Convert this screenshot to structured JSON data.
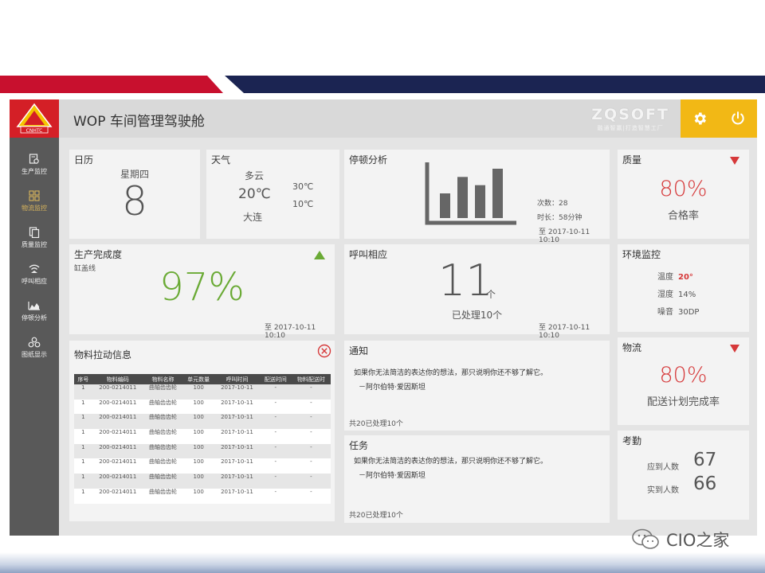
{
  "app": {
    "title": "WOP 车间管理驾驶舱",
    "logo_text": "CNHTC",
    "brand_name": "ZQSOFT",
    "brand_tagline": "融通智赢|打造智慧工厂"
  },
  "sidebar": {
    "items": [
      {
        "label": "生产监控",
        "icon": "production-monitor-icon"
      },
      {
        "label": "物流监控",
        "icon": "logistics-grid-icon",
        "active": true
      },
      {
        "label": "质量监控",
        "icon": "quality-copy-icon"
      },
      {
        "label": "呼叫相应",
        "icon": "call-signal-icon"
      },
      {
        "label": "停顿分析",
        "icon": "area-chart-icon"
      },
      {
        "label": "图纸显示",
        "icon": "drawings-icon"
      }
    ]
  },
  "calendar": {
    "title": "日历",
    "weekday": "星期四",
    "day": "8"
  },
  "weather": {
    "title": "天气",
    "condition": "多云",
    "current_temp": "20℃",
    "city": "大连",
    "high": "30℃",
    "low": "10℃"
  },
  "downtime": {
    "title": "停顿分析",
    "count_label": "次数：28",
    "duration_label": "时长：58分钟",
    "date": "至 2017-10-11 10:10"
  },
  "downtime_chart": {
    "type": "bar",
    "values": [
      3,
      5,
      4,
      6
    ],
    "note": "icon-style bar graphic, no axes"
  },
  "quality": {
    "title": "质量",
    "value": "80%",
    "caption": "合格率",
    "trend": "down"
  },
  "production": {
    "title": "生产完成度",
    "subtitle": "缸盖线",
    "value": "97%",
    "date": "至 2017-10-11 10:10",
    "trend": "up"
  },
  "call": {
    "title": "呼叫相应",
    "count": "11",
    "unit": "个",
    "caption": "已处理10个",
    "date": "至 2017-10-11 10:10"
  },
  "environment": {
    "title": "环境监控",
    "temp_label": "温度",
    "temp_value": "20°",
    "humidity_label": "湿度",
    "humidity_value": "14%",
    "noise_label": "噪音",
    "noise_value": "30DP"
  },
  "materials": {
    "title": "物料拉动信息",
    "columns": [
      "序号",
      "物料编码",
      "物料名称",
      "单元数量",
      "呼叫时间",
      "配送时间",
      "物料配送时"
    ],
    "rows": [
      [
        "1",
        "200-0214011",
        "曲轴齿齿轮",
        "100",
        "2017-10-11",
        "-",
        "-"
      ],
      [
        "1",
        "200-0214011",
        "曲轴齿齿轮",
        "100",
        "2017-10-11",
        "-",
        "-"
      ],
      [
        "1",
        "200-0214011",
        "曲轴齿齿轮",
        "100",
        "2017-10-11",
        "-",
        "-"
      ],
      [
        "1",
        "200-0214011",
        "曲轴齿齿轮",
        "100",
        "2017-10-11",
        "-",
        "-"
      ],
      [
        "1",
        "200-0214011",
        "曲轴齿齿轮",
        "100",
        "2017-10-11",
        "-",
        "-"
      ],
      [
        "1",
        "200-0214011",
        "曲轴齿齿轮",
        "100",
        "2017-10-11",
        "-",
        "-"
      ],
      [
        "1",
        "200-0214011",
        "曲轴齿齿轮",
        "100",
        "2017-10-11",
        "-",
        "-"
      ],
      [
        "1",
        "200-0214011",
        "曲轴齿齿轮",
        "100",
        "2017-10-11",
        "-",
        "-"
      ]
    ]
  },
  "notice": {
    "title": "通知",
    "text": "如果你无法简洁的表达你的想法，那只说明你还不够了解它。",
    "author": "－阿尔伯特·爱因斯坦",
    "footer": "共20已处理10个"
  },
  "task": {
    "title": "任务",
    "text": "如果你无法简洁的表达你的想法，那只说明你还不够了解它。",
    "author": "－阿尔伯特·爱因斯坦",
    "footer": "共20已处理10个"
  },
  "logistics": {
    "title": "物流",
    "value": "80%",
    "caption": "配送计划完成率",
    "trend": "down"
  },
  "attendance": {
    "title": "考勤",
    "expected_label": "应到人数",
    "expected_value": "67",
    "actual_label": "实到人数",
    "actual_value": "66"
  },
  "watermark": {
    "text": "CIO之家"
  },
  "colors": {
    "accent_red": "#d6393a",
    "accent_green": "#6aaa35",
    "accent_yellow": "#f2b815",
    "sidebar": "#595959",
    "band_red": "#c8102e",
    "band_navy": "#1b2452"
  }
}
